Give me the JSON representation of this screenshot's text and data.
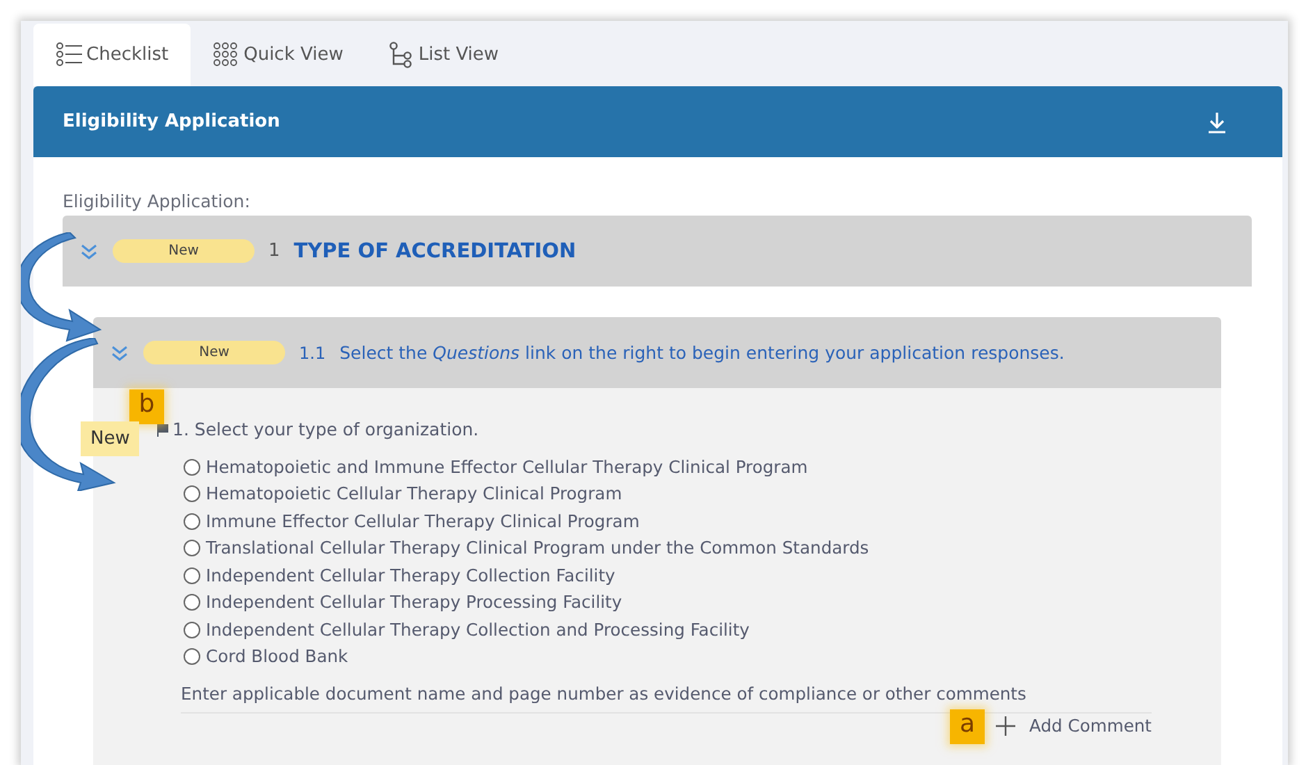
{
  "tabs": [
    {
      "label": "Checklist",
      "kind": "checklist",
      "selected": true
    },
    {
      "label": "Quick View",
      "kind": "grid",
      "selected": false
    },
    {
      "label": "List View",
      "kind": "tree",
      "selected": false
    }
  ],
  "panel": {
    "title": "Eligibility Application"
  },
  "section_label": "Eligibility Application:",
  "section": {
    "badge": "New",
    "number": "1",
    "title": "TYPE OF ACCREDITATION"
  },
  "subsection": {
    "badge": "New",
    "number": "1.1",
    "text": "Select the *Questions* link on the right to begin entering your application responses."
  },
  "question": {
    "text": "1. Select your type of organization.",
    "options": [
      {
        "label": "Hematopoietic and Immune Effector Cellular Therapy Clinical Program",
        "selected": false
      },
      {
        "label": "Hematopoietic Cellular Therapy Clinical Program",
        "selected": false
      },
      {
        "label": "Immune Effector Cellular Therapy Clinical Program",
        "selected": false
      },
      {
        "label": "Translational Cellular Therapy Clinical Program under the Common Standards",
        "selected": false
      },
      {
        "label": "Independent Cellular Therapy Collection Facility",
        "selected": false
      },
      {
        "label": "Independent Cellular Therapy Processing Facility",
        "selected": false
      },
      {
        "label": "Independent Cellular Therapy Collection and Processing Facility",
        "selected": false
      },
      {
        "label": "Cord Blood Bank",
        "selected": false
      }
    ],
    "comment_prompt": "Enter applicable document name and page number as evidence of compliance or other comments",
    "add_comment": "Add Comment"
  },
  "callouts": [
    {
      "kind": "marker",
      "label": "b"
    },
    {
      "kind": "tag",
      "label": "New"
    },
    {
      "kind": "marker",
      "label": "a"
    }
  ]
}
